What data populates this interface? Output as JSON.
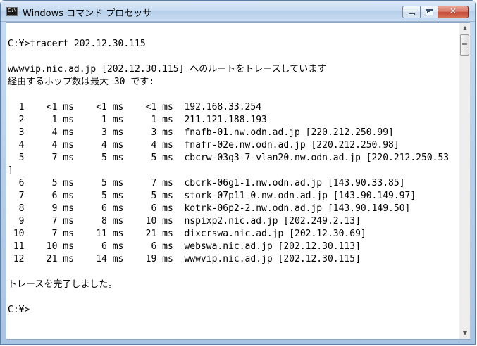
{
  "window": {
    "title": "Windows コマンド プロセッサ",
    "app_icon_label": "C:\\"
  },
  "console": {
    "lines": [
      "",
      "C:¥>tracert 202.12.30.115",
      "",
      "wwwvip.nic.ad.jp [202.12.30.115] へのルートをトレースしています",
      "経由するホップ数は最大 30 です:",
      "",
      "  1    <1 ms    <1 ms    <1 ms  192.168.33.254",
      "  2     1 ms     1 ms     1 ms  211.121.188.193",
      "  3     4 ms     3 ms     3 ms  fnafb-01.nw.odn.ad.jp [220.212.250.99]",
      "  4     4 ms     4 ms     4 ms  fnafr-02e.nw.odn.ad.jp [220.212.250.98]",
      "  5     7 ms     5 ms     5 ms  cbcrw-03g3-7-vlan20.nw.odn.ad.jp [220.212.250.53",
      "]",
      "  6     5 ms     5 ms     7 ms  cbcrk-06g1-1.nw.odn.ad.jp [143.90.33.85]",
      "  7     6 ms     5 ms     5 ms  stork-07p11-0.nw.odn.ad.jp [143.90.149.97]",
      "  8     9 ms     6 ms     6 ms  kotrk-06p2-2.nw.odn.ad.jp [143.90.149.50]",
      "  9     7 ms     8 ms    10 ms  nspixp2.nic.ad.jp [202.249.2.13]",
      " 10     7 ms    11 ms    21 ms  dixcrswa.nic.ad.jp [202.12.30.69]",
      " 11    10 ms     6 ms     6 ms  webswa.nic.ad.jp [202.12.30.113]",
      " 12    21 ms    14 ms    19 ms  wwwvip.nic.ad.jp [202.12.30.115]",
      "",
      "トレースを完了しました。",
      "",
      "C:¥>"
    ]
  },
  "icons": {
    "app": "console-app-icon",
    "minimize": "minimize-icon",
    "maximize": "maximize-icon",
    "close": "close-icon",
    "scroll_up": "scroll-up-arrow-icon",
    "scroll_down": "scroll-down-arrow-icon"
  },
  "colors": {
    "close_button": "#c44a36",
    "console_background": "#ffffff",
    "console_text": "#000000",
    "frame": "#b8d0ea"
  }
}
